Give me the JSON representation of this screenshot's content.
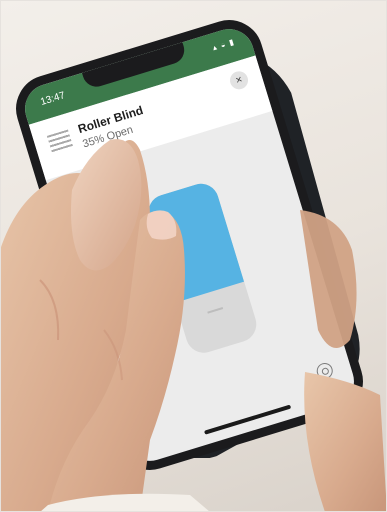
{
  "phone": {
    "status_time": "13:47",
    "status_icons": "▴ ◒ ▮"
  },
  "device": {
    "title": "Roller Blind",
    "subtitle": "35% Open",
    "open_percent": 35
  },
  "icons": {
    "blind": "blind-icon",
    "close": "close-icon",
    "settings": "gear-icon"
  },
  "colors": {
    "status_bar": "#3c7a4b",
    "slider_fill": "#56b3e3",
    "slider_track": "#d9d9d9",
    "screen_bg": "#ececec"
  }
}
